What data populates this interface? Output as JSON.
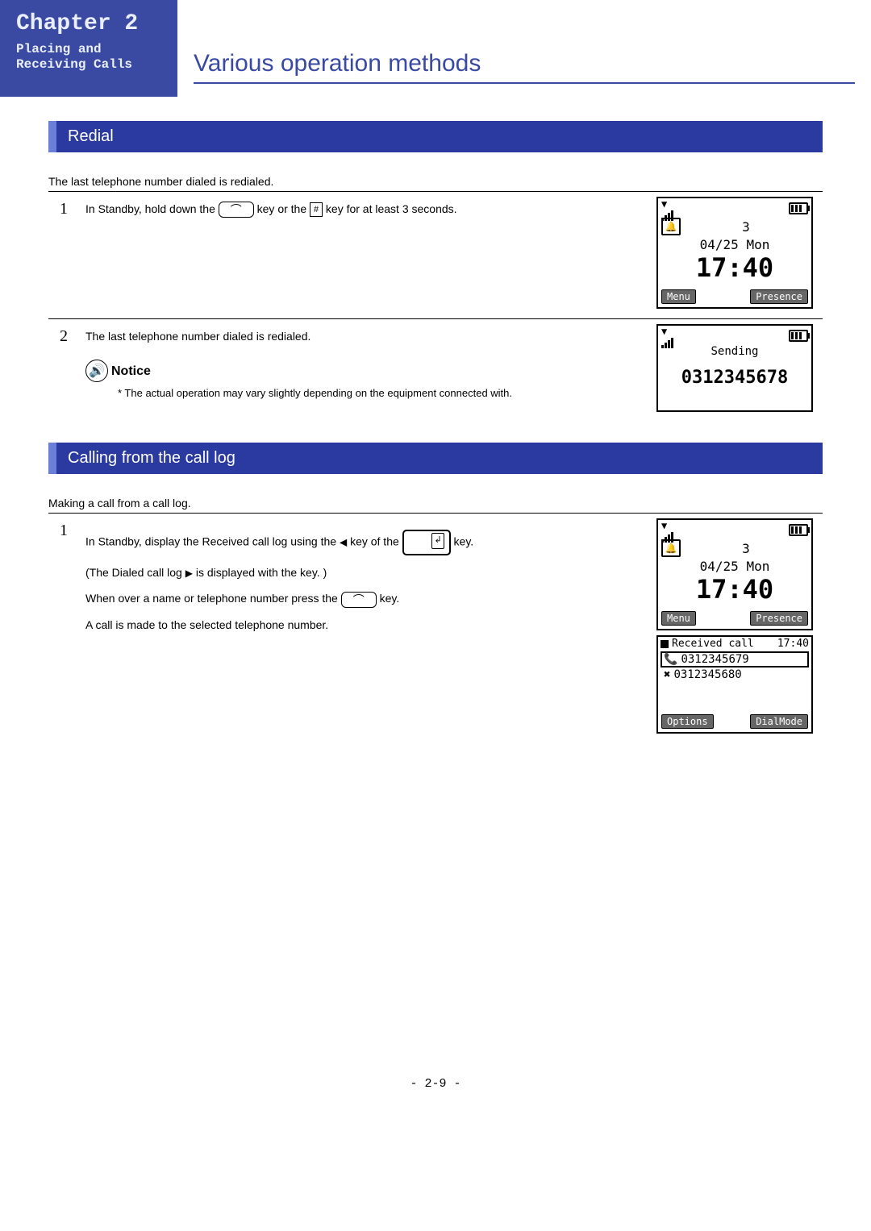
{
  "header": {
    "chapter": "Chapter 2",
    "subtitle_line1": "Placing and",
    "subtitle_line2": "Receiving Calls",
    "page_title": "Various operation methods"
  },
  "section1": {
    "title": "Redial",
    "intro": "The last telephone number dialed is redialed.",
    "steps": [
      {
        "num": "1",
        "text_a": "In Standby, hold down the ",
        "text_b": " key or the ",
        "text_c": " key for at least 3 seconds.",
        "hash": "#",
        "phone": {
          "count": "3",
          "date": "04/25 Mon",
          "time": "17:40",
          "left_btn": "Menu",
          "right_btn": "Presence"
        }
      },
      {
        "num": "2",
        "text": "The last telephone number dialed is redialed.",
        "notice_label": "Notice",
        "notice_text": "* The actual operation may vary slightly depending on the equipment connected with.",
        "phone": {
          "sending": "Sending",
          "number": "0312345678"
        }
      }
    ]
  },
  "section2": {
    "title": "Calling from the call log",
    "intro": "Making a call from a call log.",
    "steps": [
      {
        "num": "1",
        "line1_a": "In Standby, display the Received call log using the ",
        "line1_b": " key of the ",
        "line1_c": "key.",
        "line2_a": "(The Dialed call log ",
        "line2_b": "is displayed with the   key. )",
        "line3_a": "When over a name or telephone number press the ",
        "line3_b": " key.",
        "line4": "A call is made to the selected telephone number.",
        "tri_left": "◀",
        "tri_right": "▶",
        "phone": {
          "count": "3",
          "date": "04/25 Mon",
          "time": "17:40",
          "left_btn": "Menu",
          "right_btn": "Presence"
        },
        "calllog": {
          "header_a": "Received call",
          "header_b": "17:40",
          "entry1": "0312345679",
          "entry2": "0312345680",
          "left_btn": "Options",
          "right_btn": "DialMode"
        }
      }
    ]
  },
  "page_number": "- 2-9 -"
}
